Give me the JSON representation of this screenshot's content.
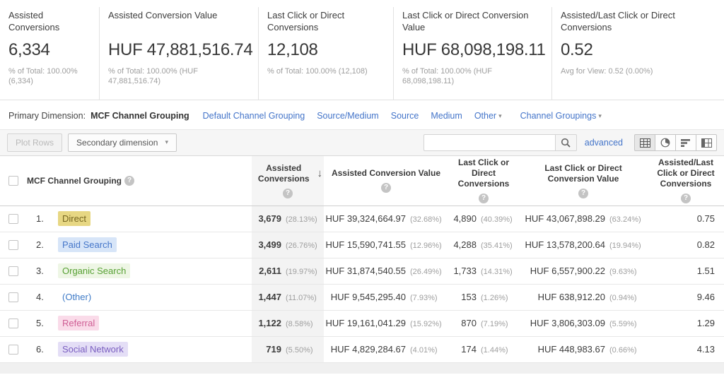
{
  "colors": {
    "link_blue": "#4374c9",
    "sorted_column_bg": "#f3f3f3"
  },
  "summary_cards": [
    {
      "title": "Assisted Conversions",
      "value": "6,334",
      "subtext": "% of Total: 100.00% (6,334)"
    },
    {
      "title": "Assisted Conversion Value",
      "value": "HUF 47,881,516.74",
      "subtext": "% of Total: 100.00% (HUF 47,881,516.74)"
    },
    {
      "title": "Last Click or Direct Conversions",
      "value": "12,108",
      "subtext": "% of Total: 100.00% (12,108)"
    },
    {
      "title": "Last Click or Direct Conversion Value",
      "value": "HUF 68,098,198.11",
      "subtext": "% of Total: 100.00% (HUF 68,098,198.11)"
    },
    {
      "title": "Assisted/Last Click or Direct Conversions",
      "value": "0.52",
      "subtext": "Avg for View: 0.52 (0.00%)"
    }
  ],
  "primary_dimension": {
    "label": "Primary Dimension:",
    "selected": "MCF Channel Grouping",
    "links": [
      "Default Channel Grouping",
      "Source/Medium",
      "Source",
      "Medium"
    ],
    "other_dropdown": "Other",
    "channel_groupings_dropdown": "Channel Groupings"
  },
  "toolbar": {
    "plot_rows_label": "Plot Rows",
    "secondary_dimension_label": "Secondary dimension",
    "search_value": "",
    "advanced_label": "advanced"
  },
  "table": {
    "dimension_header": "MCF Channel Grouping",
    "metric_headers": {
      "assisted": "Assisted Conversions",
      "acv": "Assisted Conversion Value",
      "lcd": "Last Click or Direct Conversions",
      "lcdv": "Last Click or Direct Conversion Value",
      "ratio": "Assisted/Last Click or Direct Conversions"
    },
    "rows": [
      {
        "index": "1.",
        "channel": "Direct",
        "chip": "direct",
        "assisted": "3,679",
        "assisted_pct": "(28.13%)",
        "acv": "HUF 39,324,664.97",
        "acv_pct": "(32.68%)",
        "lcd": "4,890",
        "lcd_pct": "(40.39%)",
        "lcdv": "HUF 43,067,898.29",
        "lcdv_pct": "(63.24%)",
        "ratio": "0.75"
      },
      {
        "index": "2.",
        "channel": "Paid Search",
        "chip": "paid_search",
        "assisted": "3,499",
        "assisted_pct": "(26.76%)",
        "acv": "HUF 15,590,741.55",
        "acv_pct": "(12.96%)",
        "lcd": "4,288",
        "lcd_pct": "(35.41%)",
        "lcdv": "HUF 13,578,200.64",
        "lcdv_pct": "(19.94%)",
        "ratio": "0.82"
      },
      {
        "index": "3.",
        "channel": "Organic Search",
        "chip": "organic_search",
        "assisted": "2,611",
        "assisted_pct": "(19.97%)",
        "acv": "HUF 31,874,540.55",
        "acv_pct": "(26.49%)",
        "lcd": "1,733",
        "lcd_pct": "(14.31%)",
        "lcdv": "HUF 6,557,900.22",
        "lcdv_pct": "(9.63%)",
        "ratio": "1.51"
      },
      {
        "index": "4.",
        "channel": "(Other)",
        "chip": "other",
        "assisted": "1,447",
        "assisted_pct": "(11.07%)",
        "acv": "HUF 9,545,295.40",
        "acv_pct": "(7.93%)",
        "lcd": "153",
        "lcd_pct": "(1.26%)",
        "lcdv": "HUF 638,912.20",
        "lcdv_pct": "(0.94%)",
        "ratio": "9.46"
      },
      {
        "index": "5.",
        "channel": "Referral",
        "chip": "referral",
        "assisted": "1,122",
        "assisted_pct": "(8.58%)",
        "acv": "HUF 19,161,041.29",
        "acv_pct": "(15.92%)",
        "lcd": "870",
        "lcd_pct": "(7.19%)",
        "lcdv": "HUF 3,806,303.09",
        "lcdv_pct": "(5.59%)",
        "ratio": "1.29"
      },
      {
        "index": "6.",
        "channel": "Social Network",
        "chip": "social_network",
        "assisted": "719",
        "assisted_pct": "(5.50%)",
        "acv": "HUF 4,829,284.67",
        "acv_pct": "(4.01%)",
        "lcd": "174",
        "lcd_pct": "(1.44%)",
        "lcdv": "HUF 448,983.67",
        "lcdv_pct": "(0.66%)",
        "ratio": "4.13"
      }
    ]
  },
  "channel_colors": {
    "direct": {
      "bg": "#e7d783",
      "fg": "#75651f"
    },
    "paid_search": {
      "bg": "#d7e5f8",
      "fg": "#4576c9"
    },
    "organic_search": {
      "bg": "#eef6e5",
      "fg": "#56a033"
    },
    "other": {
      "bg": "transparent",
      "fg": "#3f7bc7"
    },
    "referral": {
      "bg": "#fadbe9",
      "fg": "#cf5f95"
    },
    "social_network": {
      "bg": "#e4def6",
      "fg": "#7a5ec0"
    }
  }
}
